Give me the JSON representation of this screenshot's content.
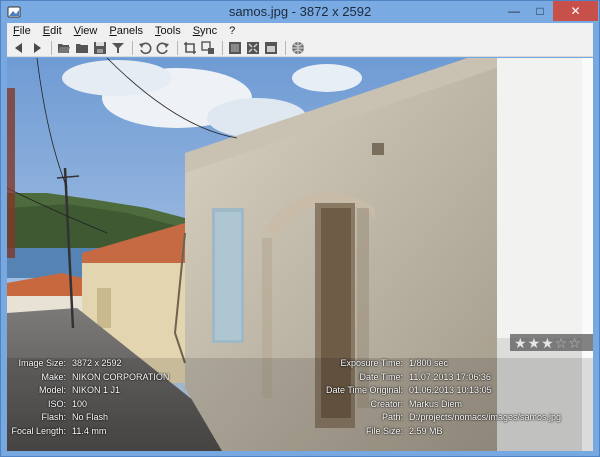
{
  "window": {
    "title": "samos.jpg - 3872 x 2592",
    "controls": {
      "minimize": "—",
      "maximize": "□",
      "close": "✕"
    }
  },
  "menu": [
    {
      "label": "File",
      "name": "menu-file"
    },
    {
      "label": "Edit",
      "name": "menu-edit"
    },
    {
      "label": "View",
      "name": "menu-view"
    },
    {
      "label": "Panels",
      "name": "menu-panels"
    },
    {
      "label": "Tools",
      "name": "menu-tools"
    },
    {
      "label": "Sync",
      "name": "menu-sync"
    },
    {
      "label": "?",
      "name": "menu-help"
    }
  ],
  "toolbar": {
    "icons": [
      "arrow-left-icon",
      "arrow-right-icon",
      "folder-open-icon",
      "folder-icon",
      "save-icon",
      "filter-icon",
      "rotate-left-icon",
      "rotate-right-icon",
      "crop-icon",
      "resize-icon",
      "grid-icon",
      "fullscreen-icon",
      "frameless-icon",
      "globe-icon"
    ]
  },
  "rating": {
    "value": 3,
    "max": 5
  },
  "metadata_left": [
    {
      "key": "Image Size:",
      "value": "3872 x 2592"
    },
    {
      "key": "Make:",
      "value": "NIKON CORPORATION"
    },
    {
      "key": "Model:",
      "value": "NIKON 1 J1"
    },
    {
      "key": "ISO:",
      "value": "100"
    },
    {
      "key": "Flash:",
      "value": "No Flash"
    },
    {
      "key": "Focal Length:",
      "value": "11.4 mm"
    }
  ],
  "metadata_right": [
    {
      "key": "Exposure Time:",
      "value": "1/800 sec"
    },
    {
      "key": "Date Time:",
      "value": "11.07.2013 17:06:36"
    },
    {
      "key": "Date Time Original:",
      "value": "01.06.2013 10:13:05"
    },
    {
      "key": "Creator:",
      "value": "Markus Diem"
    },
    {
      "key": "Path:",
      "value": "D:/projects/nomacs/images/samos.jpg"
    },
    {
      "key": "File Size:",
      "value": "2.59 MB"
    }
  ]
}
